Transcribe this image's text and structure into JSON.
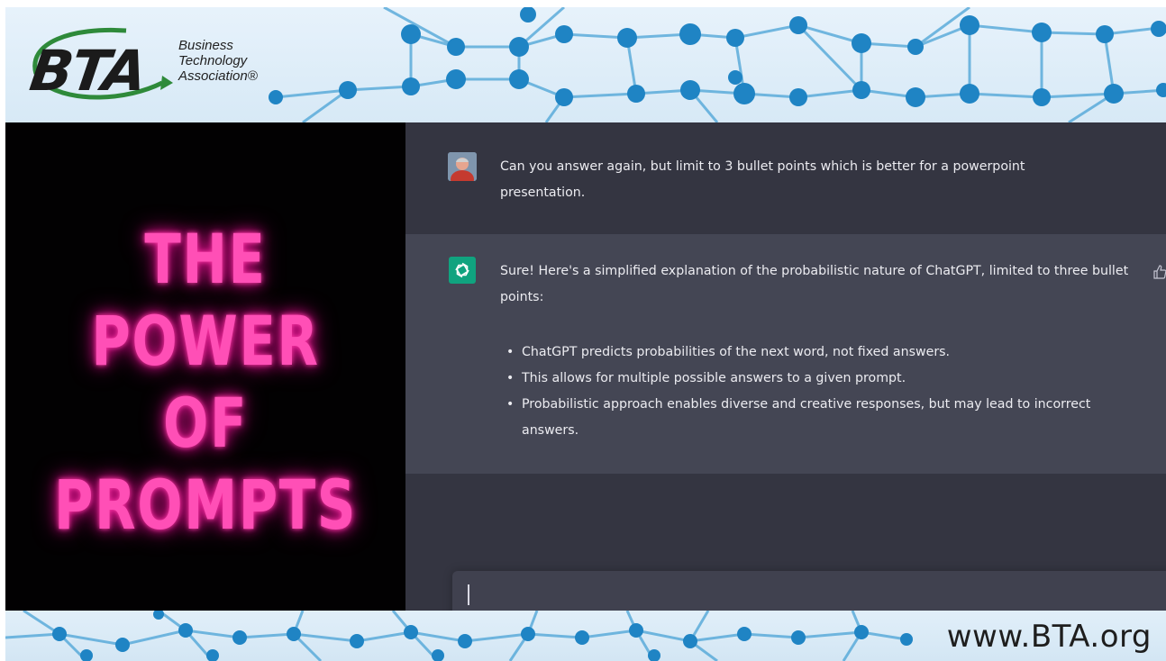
{
  "org": {
    "logo_letters": "BTA",
    "logo_name_lines": [
      "Business",
      "Technology",
      "Association®"
    ],
    "website": "www.BTA.org"
  },
  "slide": {
    "title_lines": [
      "THE POWER",
      "OF",
      "PROMPTS"
    ],
    "neon_color": "#ff4fb6"
  },
  "chat": {
    "user_message": "Can you answer again, but limit to 3 bullet points which is better for a powerpoint presentation.",
    "assistant_intro": "Sure! Here's a simplified explanation of the probabilistic nature of ChatGPT, limited to three bullet points:",
    "assistant_bullets": [
      "ChatGPT predicts probabilities of the next word, not fixed answers.",
      "This allows for multiple possible answers to a given prompt.",
      "Probabilistic approach enables diverse and creative responses, but may lead to incorrect answers."
    ],
    "bullet_glyph": "•",
    "icons": {
      "user_avatar": "user-avatar",
      "assistant_avatar": "openai-logo-icon",
      "feedback": "thumbs-up-icon"
    },
    "colors": {
      "user_bg": "#343541",
      "assistant_bg": "#444654",
      "assistant_avatar_bg": "#10a37f",
      "input_bg": "#40414f"
    }
  }
}
